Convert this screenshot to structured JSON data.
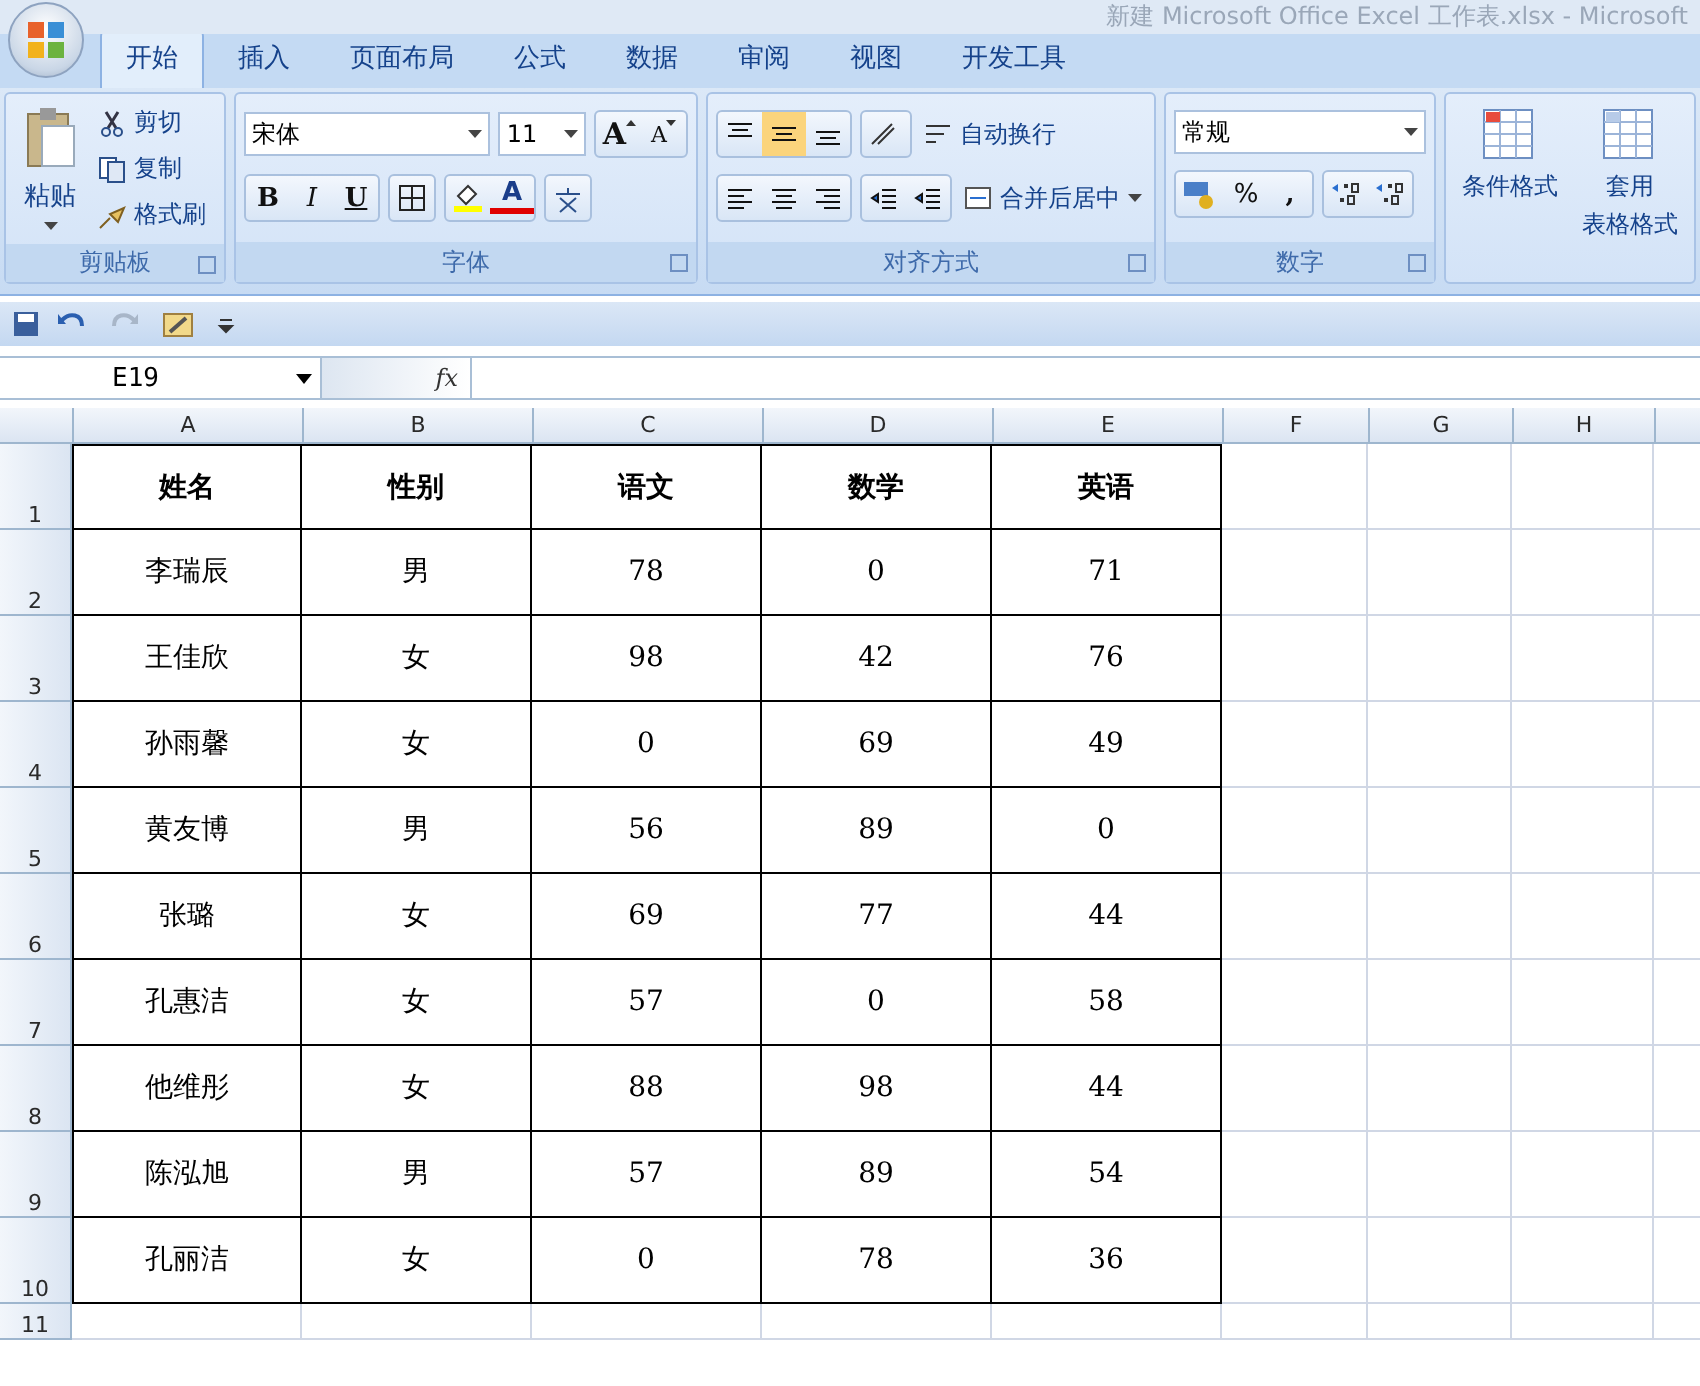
{
  "window": {
    "title": "新建 Microsoft Office Excel 工作表.xlsx - Microsoft"
  },
  "tabs": [
    {
      "label": "开始",
      "selected": true
    },
    {
      "label": "插入",
      "selected": false
    },
    {
      "label": "页面布局",
      "selected": false
    },
    {
      "label": "公式",
      "selected": false
    },
    {
      "label": "数据",
      "selected": false
    },
    {
      "label": "审阅",
      "selected": false
    },
    {
      "label": "视图",
      "selected": false
    },
    {
      "label": "开发工具",
      "selected": false
    }
  ],
  "clipboard": {
    "paste": "粘贴",
    "actions": [
      {
        "label": "剪切"
      },
      {
        "label": "复制"
      },
      {
        "label": "格式刷"
      }
    ],
    "group_label": "剪贴板"
  },
  "font": {
    "name": "宋体",
    "size": "11",
    "grow_letter": "A",
    "shrink_letter": "A",
    "bold": "B",
    "italic": "I",
    "underline": "U",
    "color_letter": "A",
    "group_label": "字体"
  },
  "alignment": {
    "vertical": [
      {
        "selected": false
      },
      {
        "selected": true
      },
      {
        "selected": false
      }
    ],
    "wrap": "自动换行",
    "merge": "合并后居中",
    "group_label": "对齐方式"
  },
  "number": {
    "format": "常规",
    "percent": "%",
    "comma": ",",
    "group_label": "数字"
  },
  "styles": {
    "buttons": [
      {
        "lines": [
          "条件格式"
        ]
      },
      {
        "lines": [
          "套用",
          "表格格式"
        ]
      }
    ]
  },
  "name_box": {
    "value": "E19"
  },
  "formula_bar": {
    "fx": "fx"
  },
  "sheet": {
    "columns": [
      "A",
      "B",
      "C",
      "D",
      "E",
      "F",
      "G",
      "H"
    ],
    "rows": [
      {
        "number": "1",
        "kind": "header",
        "cells": [
          "姓名",
          "性别",
          "语文",
          "数学",
          "英语"
        ]
      },
      {
        "number": "2",
        "kind": "data",
        "cells": [
          "李瑞辰",
          "男",
          "78",
          "0",
          "71"
        ]
      },
      {
        "number": "3",
        "kind": "data",
        "cells": [
          "王佳欣",
          "女",
          "98",
          "42",
          "76"
        ]
      },
      {
        "number": "4",
        "kind": "data",
        "cells": [
          "孙雨馨",
          "女",
          "0",
          "69",
          "49"
        ]
      },
      {
        "number": "5",
        "kind": "data",
        "cells": [
          "黄友博",
          "男",
          "56",
          "89",
          "0"
        ]
      },
      {
        "number": "6",
        "kind": "data",
        "cells": [
          "张璐",
          "女",
          "69",
          "77",
          "44"
        ]
      },
      {
        "number": "7",
        "kind": "data",
        "cells": [
          "孔惠洁",
          "女",
          "57",
          "0",
          "58"
        ]
      },
      {
        "number": "8",
        "kind": "data",
        "cells": [
          "他维彤",
          "女",
          "88",
          "98",
          "44"
        ]
      },
      {
        "number": "9",
        "kind": "data",
        "cells": [
          "陈泓旭",
          "男",
          "57",
          "89",
          "54"
        ]
      },
      {
        "number": "10",
        "kind": "data",
        "cells": [
          "孔丽洁",
          "女",
          "0",
          "78",
          "36"
        ]
      },
      {
        "number": "11",
        "kind": "empty"
      }
    ]
  }
}
